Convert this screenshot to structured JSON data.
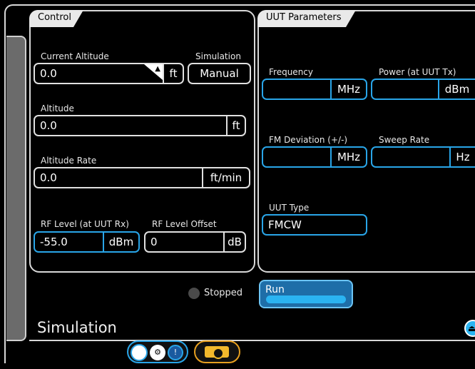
{
  "control": {
    "tab_label": "Control",
    "current_altitude": {
      "label": "Current Altitude",
      "value": "0.0",
      "unit": "ft"
    },
    "simulation": {
      "label": "Simulation",
      "value": "Manual"
    },
    "altitude": {
      "label": "Altitude",
      "value": "0.0",
      "unit": "ft"
    },
    "altitude_rate": {
      "label": "Altitude Rate",
      "value": "0.0",
      "unit": "ft/min"
    },
    "rf_level": {
      "label": "RF Level (at UUT Rx)",
      "value": "-55.0",
      "unit": "dBm"
    },
    "rf_level_offset": {
      "label": "RF Level Offset",
      "value": "0",
      "unit": "dB"
    }
  },
  "uut": {
    "tab_label": "UUT Parameters",
    "frequency": {
      "label": "Frequency",
      "value": "",
      "unit": "MHz"
    },
    "power": {
      "label": "Power (at UUT Tx)",
      "value": "",
      "unit": "dBm"
    },
    "fm_deviation": {
      "label": "FM Deviation (+/-)",
      "value": "",
      "unit": "MHz"
    },
    "sweep_rate": {
      "label": "Sweep Rate",
      "value": "",
      "unit": "Hz"
    },
    "uut_type": {
      "label": "UUT Type",
      "value": "FMCW"
    }
  },
  "status": {
    "text": "Stopped"
  },
  "run_button": {
    "label": "Run"
  },
  "section": {
    "title": "Simulation"
  },
  "icons": {
    "lock": "lock-icon",
    "toggle_knob": "toggle-knob-icon",
    "settings": "settings-icon",
    "info": "info-icon",
    "camera": "camera-icon",
    "eject": "eject-icon"
  },
  "colors": {
    "accent_blue": "#29a5e8",
    "run_fill": "#1e6ea8",
    "camera_yellow": "#f2b82c",
    "status_dot": "#4a4a4a"
  }
}
